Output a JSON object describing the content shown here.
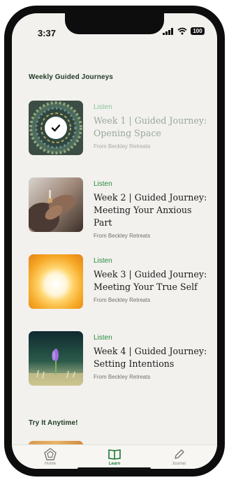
{
  "status_bar": {
    "time": "3:37",
    "battery": "100"
  },
  "sections": {
    "weekly_title": "Weekly Guided Journeys",
    "anytime_title": "Try It Anytime!"
  },
  "journeys": [
    {
      "action": "Listen",
      "title": "Week 1 | Guided Journey: Opening Space",
      "source": "From Beckley Retreats",
      "completed": true,
      "thumbnail": "mosaic-dome-icon"
    },
    {
      "action": "Listen",
      "title": "Week 2 | Guided Journey: Meeting Your Anxious Part",
      "source": "From Beckley Retreats",
      "completed": false,
      "thumbnail": "hands-photo"
    },
    {
      "action": "Listen",
      "title": "Week 3 | Guided Journey: Meeting Your True Self",
      "source": "From Beckley Retreats",
      "completed": false,
      "thumbnail": "sun-glow-image"
    },
    {
      "action": "Listen",
      "title": "Week 4 | Guided Journey: Setting Intentions",
      "source": "From Beckley Retreats",
      "completed": false,
      "thumbnail": "crocus-flower-photo"
    }
  ],
  "tabs": [
    {
      "label": "Home",
      "icon": "home-icon",
      "active": false
    },
    {
      "label": "Learn",
      "icon": "book-icon",
      "active": true
    },
    {
      "label": "Journal",
      "icon": "pencil-icon",
      "active": false
    }
  ],
  "colors": {
    "accent": "#2b8a3e",
    "heading": "#1f3a24",
    "background": "#f2f1ee"
  }
}
